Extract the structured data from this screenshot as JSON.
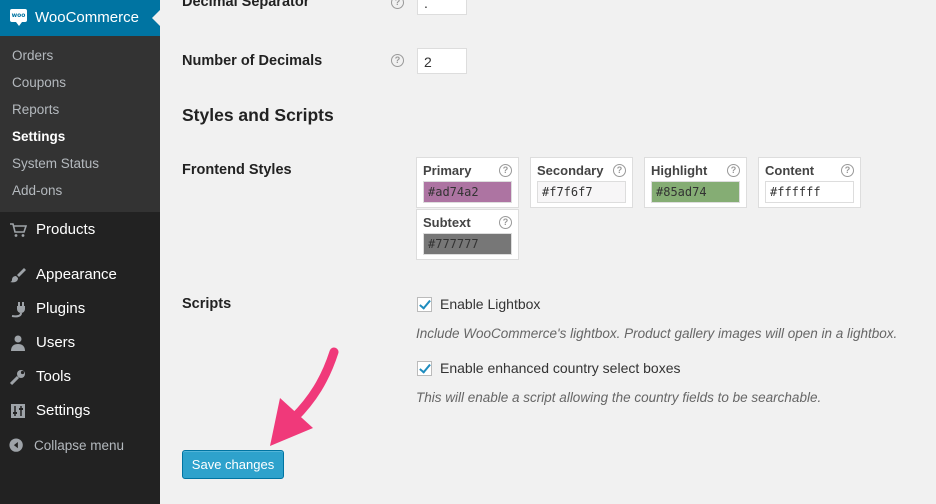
{
  "sidebar": {
    "header": {
      "title": "WooCommerce",
      "icon": "woo-icon",
      "badge": "woo"
    },
    "submenu": [
      {
        "label": "Orders"
      },
      {
        "label": "Coupons"
      },
      {
        "label": "Reports"
      },
      {
        "label": "Settings",
        "current": true
      },
      {
        "label": "System Status"
      },
      {
        "label": "Add-ons"
      }
    ],
    "menu": [
      {
        "label": "Products",
        "icon": "cart-icon"
      },
      {
        "label": "Appearance",
        "icon": "paintbrush-icon"
      },
      {
        "label": "Plugins",
        "icon": "plug-icon"
      },
      {
        "label": "Users",
        "icon": "user-icon"
      },
      {
        "label": "Tools",
        "icon": "wrench-icon"
      },
      {
        "label": "Settings",
        "icon": "sliders-icon"
      }
    ],
    "collapse_label": "Collapse menu"
  },
  "main": {
    "decimal_separator": {
      "label": "Decimal Separator",
      "value": "."
    },
    "num_decimals": {
      "label": "Number of Decimals",
      "value": "2"
    },
    "section_title": "Styles and Scripts",
    "frontend_styles": {
      "label": "Frontend Styles",
      "colors": [
        {
          "name": "Primary",
          "value": "#ad74a2",
          "swatch": "#ad74a2"
        },
        {
          "name": "Secondary",
          "value": "#f7f6f7",
          "swatch": "#f7f6f7"
        },
        {
          "name": "Highlight",
          "value": "#85ad74",
          "swatch": "#85ad74"
        },
        {
          "name": "Content",
          "value": "#ffffff",
          "swatch": "#ffffff"
        },
        {
          "name": "Subtext",
          "value": "#777777",
          "swatch": "#777777"
        }
      ]
    },
    "scripts": {
      "label": "Scripts",
      "lightbox": {
        "label": "Enable Lightbox",
        "checked": true,
        "description": "Include WooCommerce's lightbox. Product gallery images will open in a lightbox."
      },
      "country_select": {
        "label": "Enable enhanced country select boxes",
        "checked": true,
        "description": "This will enable a script allowing the country fields to be searchable."
      }
    },
    "save_label": "Save changes",
    "help_glyph": "?"
  },
  "colors": {
    "sidebar_bg": "#222222",
    "submenu_bg": "#333333",
    "active_menu": "#0074a2",
    "button": "#2ea2cc",
    "arrow": "#f0397a"
  }
}
